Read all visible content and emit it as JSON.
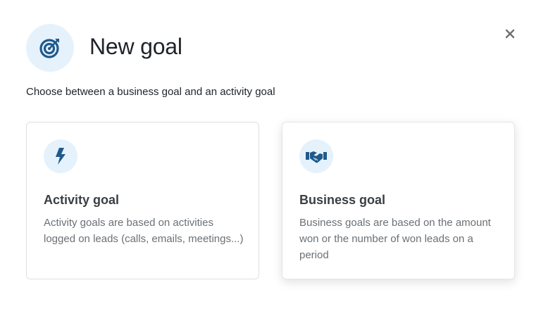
{
  "dialog": {
    "title": "New goal",
    "header_icon": "target-icon",
    "close_icon": "close-icon",
    "subtitle": "Choose between a business goal and an activity goal"
  },
  "options": [
    {
      "icon": "lightning-bolt-icon",
      "title": "Activity goal",
      "description": "Activity goals are based on activities logged on leads (calls, emails, meetings...)"
    },
    {
      "icon": "handshake-icon",
      "title": "Business goal",
      "description": "Business goals are based on the amount won or the number of won leads on a period"
    }
  ],
  "colors": {
    "icon_blue": "#1f5a8c",
    "icon_bg": "#e6f2fb"
  }
}
